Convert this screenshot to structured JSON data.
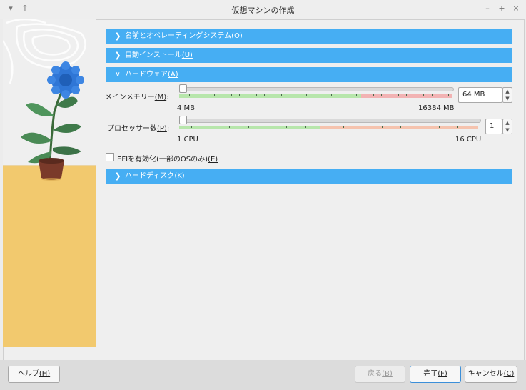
{
  "window": {
    "title": "仮想マシンの作成",
    "left_icons": [
      "▾",
      "↑"
    ],
    "right_icons": [
      "–",
      "+",
      "×"
    ]
  },
  "sections": [
    {
      "label": "名前とオペレーティングシステム",
      "mnemonic": "(O)",
      "expanded": false
    },
    {
      "label": "自動インストール",
      "mnemonic": "(U)",
      "expanded": false
    },
    {
      "label": "ハードウェア",
      "mnemonic": "(A)",
      "expanded": true
    },
    {
      "label": "ハードディスク",
      "mnemonic": "(K)",
      "expanded": false
    }
  ],
  "hardware": {
    "memory": {
      "label": "メインメモリー",
      "mnemonic": "(M)",
      "suffix": ":",
      "min_label": "4 MB",
      "max_label": "16384 MB",
      "value": "64 MB"
    },
    "processor": {
      "label": "プロセッサー数",
      "mnemonic": "(P)",
      "suffix": ":",
      "min_label": "1 CPU",
      "max_label": "16 CPU",
      "value": "1"
    },
    "efi": {
      "label": "EFIを有効化(一部のOSのみ)",
      "mnemonic": "(E)",
      "checked": false
    }
  },
  "buttons": {
    "help": {
      "label": "ヘルプ",
      "mnemonic": "(H)"
    },
    "back": {
      "label": "戻る",
      "mnemonic": "(B)"
    },
    "finish": {
      "label": "完了",
      "mnemonic": "(F)"
    },
    "cancel": {
      "label": "キャンセル",
      "mnemonic": "(C)"
    }
  },
  "colors": {
    "accent": "#46aef3",
    "slider_good": "#b7e6ab",
    "slider_warn": "#f2b3b3",
    "slider_warn_cpu": "#f5c3ae",
    "wall_top": "#eeeeee",
    "wall_bottom": "#f2c96e"
  }
}
